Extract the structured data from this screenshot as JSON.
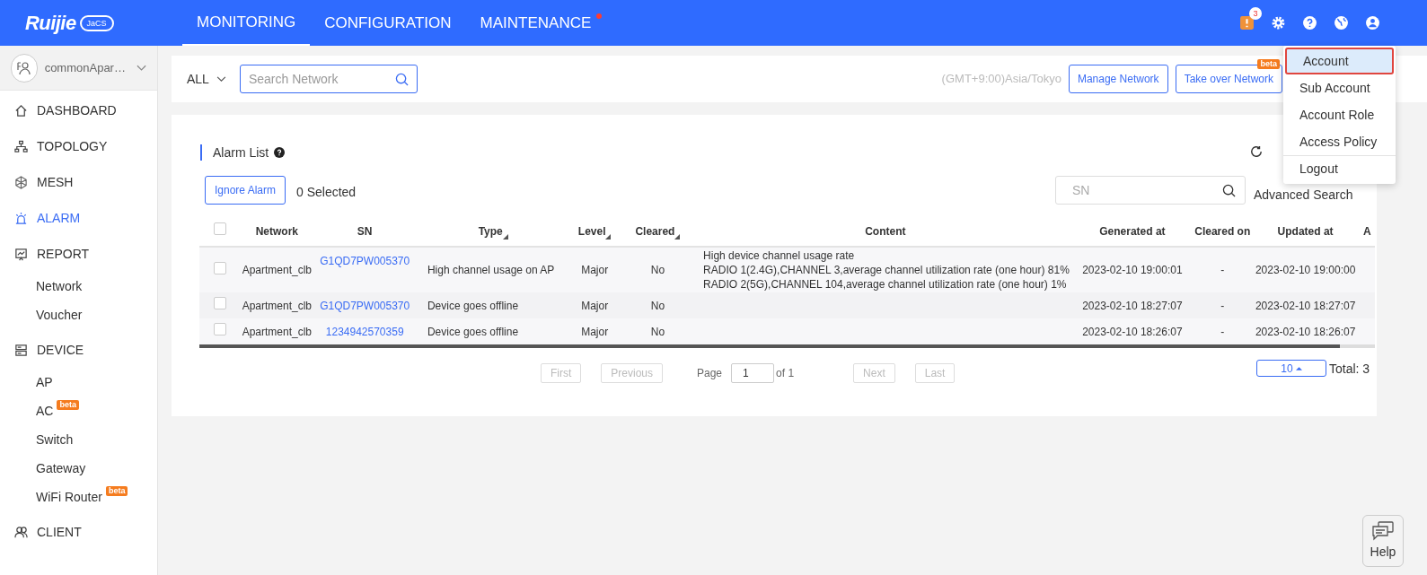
{
  "logo": {
    "brand": "Ruijie",
    "product": "JaCS"
  },
  "top_nav": [
    {
      "label": "MONITORING",
      "selected": true,
      "dot": false
    },
    {
      "label": "CONFIGURATION",
      "selected": false,
      "dot": false
    },
    {
      "label": "MAINTENANCE",
      "selected": false,
      "dot": true
    }
  ],
  "notification_count": "3",
  "account": {
    "name": "commonApar…"
  },
  "sidebar": {
    "items": [
      {
        "label": "DASHBOARD",
        "selected": false
      },
      {
        "label": "TOPOLOGY",
        "selected": false
      },
      {
        "label": "MESH",
        "selected": false
      },
      {
        "label": "ALARM",
        "selected": true
      },
      {
        "label": "REPORT",
        "selected": false,
        "children": [
          {
            "label": "Network",
            "selected": false
          },
          {
            "label": "Voucher",
            "selected": false
          }
        ]
      },
      {
        "label": "DEVICE",
        "selected": false,
        "children": [
          {
            "label": "AP",
            "selected": false
          },
          {
            "label": "AC",
            "selected": false,
            "badge": "beta"
          },
          {
            "label": "Switch",
            "selected": false
          },
          {
            "label": "Gateway",
            "selected": false
          },
          {
            "label": "WiFi Router",
            "selected": false,
            "badge": "beta"
          }
        ]
      },
      {
        "label": "CLIENT",
        "selected": false
      }
    ]
  },
  "filter_bar": {
    "scope": "ALL",
    "search": {
      "placeholder": "Search Network"
    },
    "timezone": "(GMT+9:00)Asia/Tokyo",
    "buttons": [
      {
        "label": "Manage Network"
      },
      {
        "label": "Take over Network",
        "badge": "beta"
      }
    ]
  },
  "account_menu": [
    {
      "label": "Account",
      "selected": true
    },
    {
      "label": "Sub Account",
      "selected": false
    },
    {
      "label": "Account Role",
      "selected": false
    },
    {
      "label": "Access Policy",
      "selected": false
    },
    {
      "label": "Logout",
      "selected": false
    }
  ],
  "alarm_list": {
    "title": "Alarm List",
    "select_all": false,
    "ignore_button": "Ignore Alarm",
    "selected_count": "0 Selected",
    "sn_search": {
      "placeholder": "SN"
    },
    "advanced_search": "Advanced Search",
    "columns": [
      {
        "label": "Network",
        "sortable": false
      },
      {
        "label": "SN",
        "sortable": false
      },
      {
        "label": "Type",
        "sortable": true
      },
      {
        "label": "Level",
        "sortable": true
      },
      {
        "label": "Cleared",
        "sortable": true
      },
      {
        "label": "Content",
        "sortable": false
      },
      {
        "label": "Generated at",
        "sortable": false
      },
      {
        "label": "Cleared on",
        "sortable": false
      },
      {
        "label": "Updated at",
        "sortable": false
      },
      {
        "label": "A",
        "sortable": false
      }
    ],
    "rows": [
      {
        "checked": false,
        "network": "Apartment_clb",
        "sn": "G1QD7PW005370",
        "type": "High channel usage on AP",
        "level": "Major",
        "cleared": "No",
        "content": [
          "High device channel usage rate",
          "RADIO 1(2.4G),CHANNEL 3,average channel utilization rate (one hour) 81%",
          "RADIO 2(5G),CHANNEL 104,average channel utilization rate (one hour) 1%"
        ],
        "generated_at": "2023-02-10 19:00:01",
        "cleared_on": "-",
        "updated_at": "2023-02-10 19:00:00"
      },
      {
        "checked": false,
        "network": "Apartment_clb",
        "sn": "G1QD7PW005370",
        "type": "Device goes offline",
        "level": "Major",
        "cleared": "No",
        "generated_at": "2023-02-10 18:27:07",
        "cleared_on": "-",
        "updated_at": "2023-02-10 18:27:07"
      },
      {
        "checked": false,
        "network": "Apartment_clb",
        "sn": "1234942570359",
        "type": "Device goes offline",
        "level": "Major",
        "cleared": "No",
        "generated_at": "2023-02-10 18:26:07",
        "cleared_on": "-",
        "updated_at": "2023-02-10 18:26:07"
      }
    ],
    "pagination": {
      "first": "First",
      "previous": "Previous",
      "page_label": "Page",
      "page": "1",
      "of": "of 1",
      "next": "Next",
      "last": "Last",
      "page_size": "10",
      "total": "Total: 3"
    }
  },
  "help": "Help"
}
